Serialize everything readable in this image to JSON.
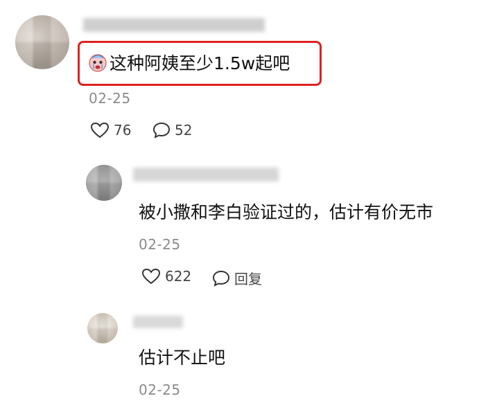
{
  "comments": [
    {
      "text": "这种阿姨至少1.5w起吧",
      "emoji_icon": "crying-face-icon",
      "date": "02-25",
      "likes": "76",
      "replies": "52"
    },
    {
      "text": "被小撒和李白验证过的，估计有价无市",
      "date": "02-25",
      "likes": "622",
      "reply_label": "回复"
    },
    {
      "text": "估计不止吧",
      "date": "02-25"
    }
  ],
  "colors": {
    "highlight": "#e02020",
    "date": "#8a8a8a",
    "text": "#111111"
  }
}
